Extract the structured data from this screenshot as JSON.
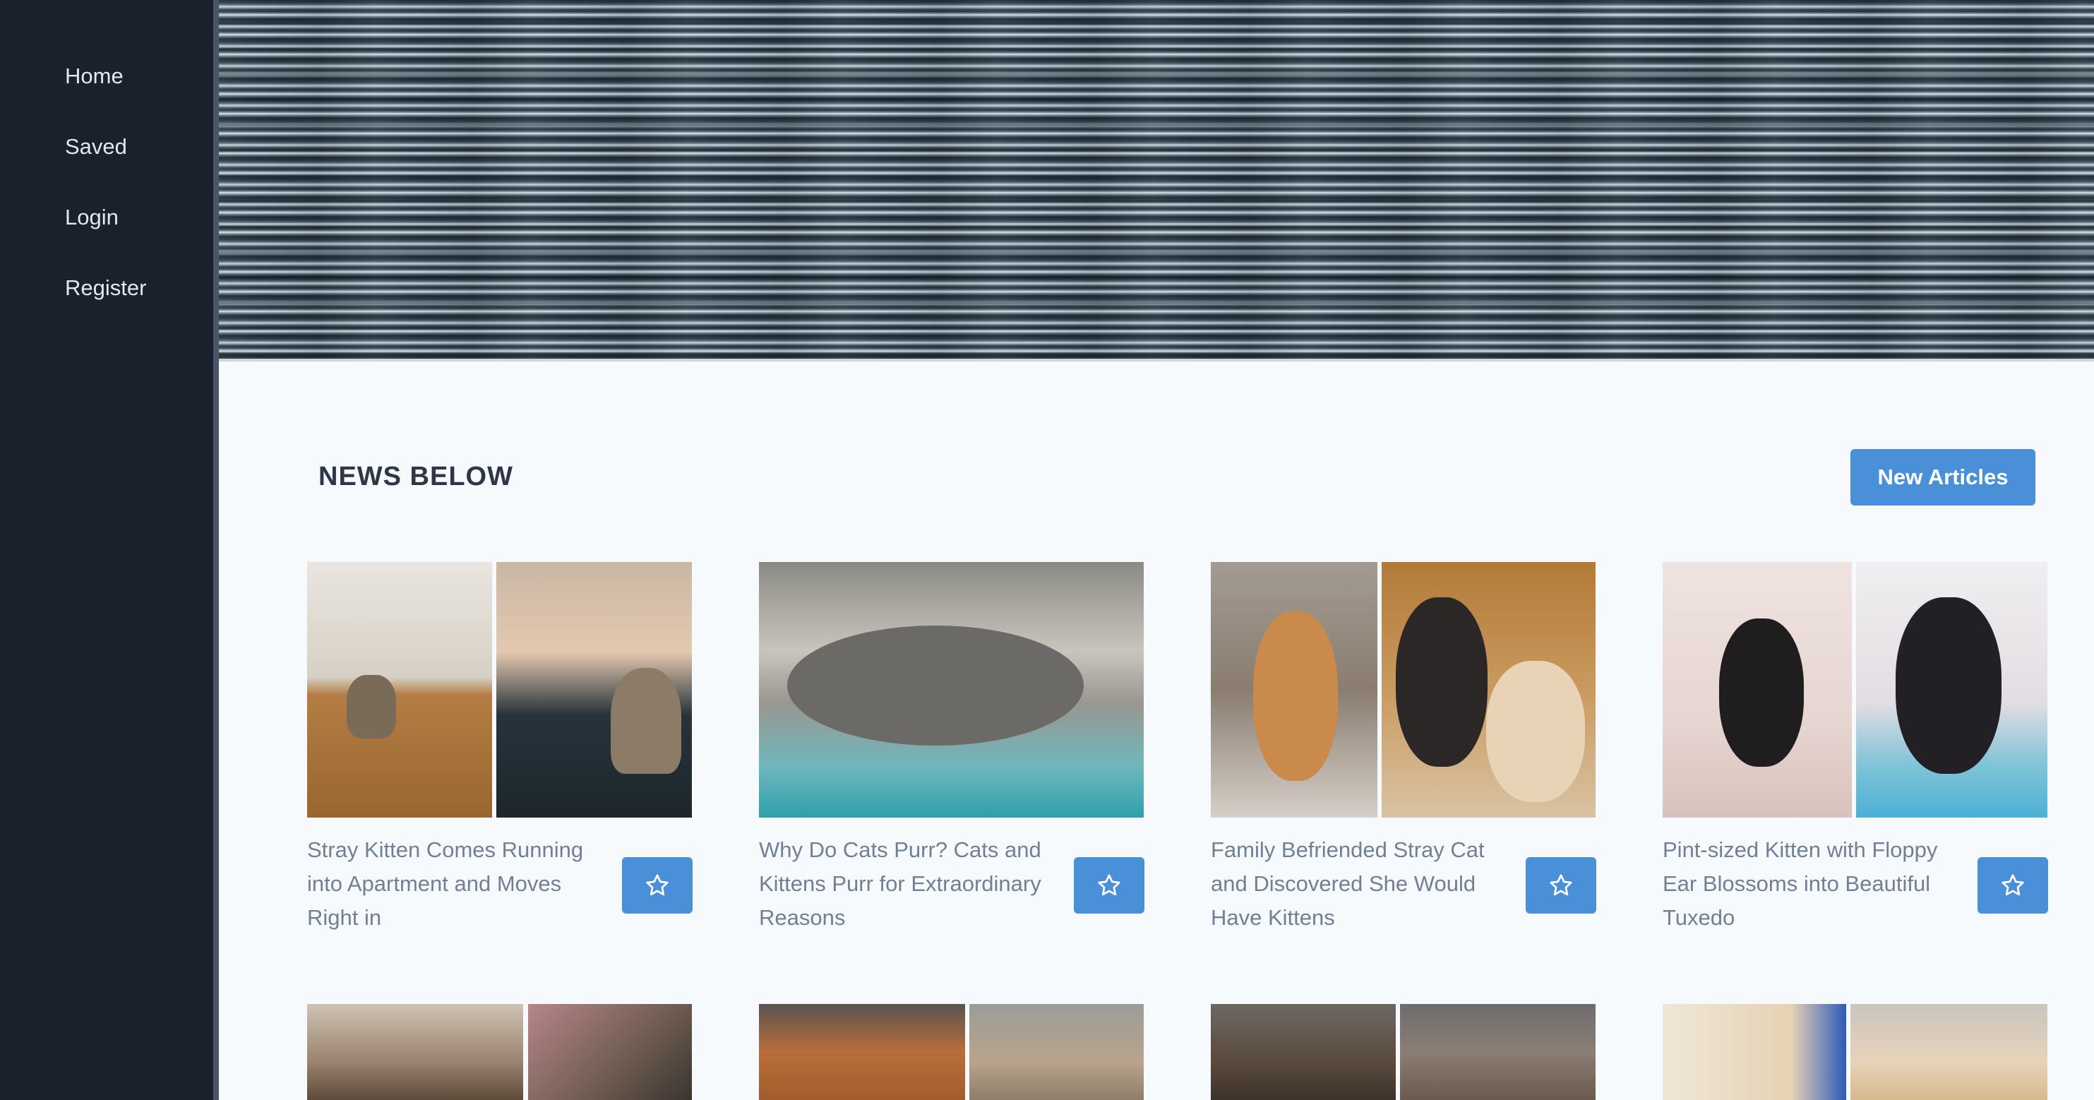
{
  "sidebar": {
    "items": [
      {
        "label": "Home"
      },
      {
        "label": "Saved"
      },
      {
        "label": "Login"
      },
      {
        "label": "Register"
      }
    ]
  },
  "main": {
    "section_title": "NEWS BELOW",
    "new_articles_label": "New Articles",
    "accent_color": "#4a90d9",
    "articles": [
      {
        "title": "Stray Kitten Comes Running into Apartment and Moves Right in",
        "action_icon": "star-outline-icon"
      },
      {
        "title": "Why Do Cats Purr? Cats and Kittens Purr for Extraordinary Reasons",
        "action_icon": "star-outline-icon"
      },
      {
        "title": "Family Befriended Stray Cat and Discovered She Would Have Kittens",
        "action_icon": "star-outline-icon"
      },
      {
        "title": "Pint-sized Kitten with Floppy Ear Blossoms into Beautiful Tuxedo",
        "action_icon": "star-outline-icon"
      }
    ]
  }
}
